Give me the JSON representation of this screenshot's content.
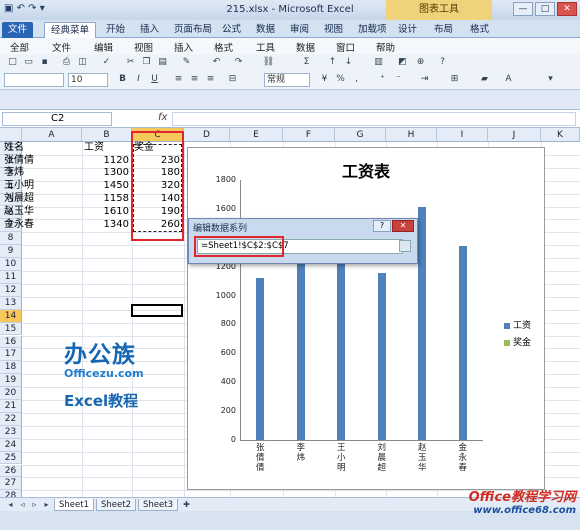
{
  "window": {
    "title": "215.xlsx - Microsoft Excel",
    "context_tools": "图表工具"
  },
  "ribbon_tabs": [
    "文件",
    "经典菜单",
    "开始",
    "插入",
    "页面布局",
    "公式",
    "数据",
    "审阅",
    "视图",
    "加载项",
    "设计",
    "布局",
    "格式"
  ],
  "classic_menu": [
    "全部",
    "文件",
    "编辑",
    "视图",
    "插入",
    "格式",
    "工具",
    "数据",
    "窗口",
    "帮助"
  ],
  "toolbar": {
    "font_size": "10",
    "number_format": "常规"
  },
  "formula_bar": {
    "name_box": "C2",
    "fx": "fx",
    "formula": ""
  },
  "columns": [
    "A",
    "B",
    "C",
    "D",
    "E",
    "F",
    "G",
    "H",
    "I",
    "J",
    "K"
  ],
  "rows": [
    "1",
    "2",
    "3",
    "4",
    "5",
    "6",
    "7",
    "8",
    "9",
    "10",
    "11",
    "12",
    "13",
    "14",
    "15",
    "16",
    "17",
    "18",
    "19",
    "20",
    "21",
    "22",
    "23",
    "24",
    "25",
    "26",
    "27",
    "28"
  ],
  "table": {
    "headers": [
      "姓名",
      "工资",
      "奖金"
    ],
    "rows": [
      [
        "张倩倩",
        "1120",
        "230"
      ],
      [
        "李炜",
        "1300",
        "180"
      ],
      [
        "王小明",
        "1450",
        "320"
      ],
      [
        "刘晨超",
        "1158",
        "140"
      ],
      [
        "赵玉华",
        "1610",
        "190"
      ],
      [
        "金永春",
        "1340",
        "260"
      ]
    ]
  },
  "chart_data": {
    "type": "bar",
    "title": "工资表",
    "categories": [
      "张倩倩",
      "李炜",
      "王小明",
      "刘晨超",
      "赵玉华",
      "金永春"
    ],
    "series": [
      {
        "name": "工资",
        "values": [
          1120,
          1300,
          1450,
          1158,
          1610,
          1340
        ],
        "color": "#4f81bd"
      },
      {
        "name": "奖金",
        "values": [],
        "color": "#9bbb59"
      }
    ],
    "ylim": [
      0,
      1800
    ],
    "yticks": [
      "0",
      "200",
      "400",
      "600",
      "800",
      "1000",
      "1200",
      "1400",
      "1600",
      "1800"
    ],
    "legend": "right"
  },
  "dialog": {
    "title": "编辑数据系列",
    "help": "?",
    "close": "✕",
    "value": "=Sheet1!$C$2:$C$7"
  },
  "logo": {
    "brand": "办公族",
    "site": "Officezu.com",
    "tag": "Excel教程"
  },
  "sheets": [
    "Sheet1",
    "Sheet2",
    "Sheet3"
  ],
  "watermark": {
    "line1": "Office教程学习网",
    "line2": "www.office68.com"
  }
}
